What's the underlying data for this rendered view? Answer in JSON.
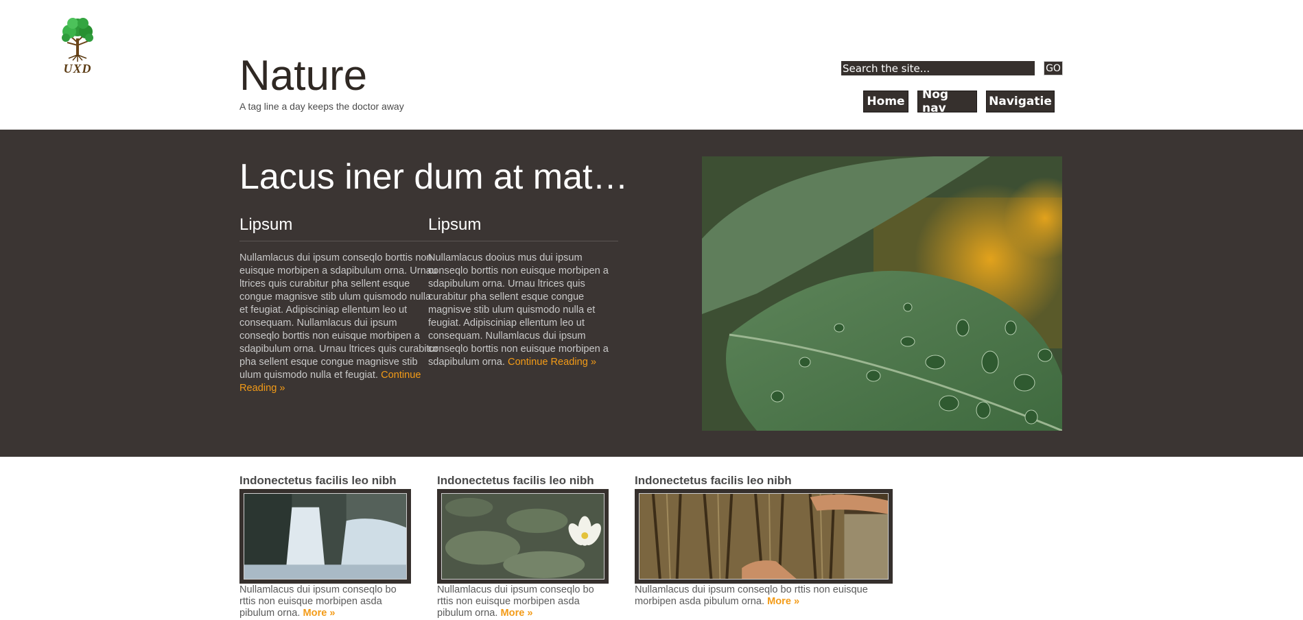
{
  "header": {
    "logo_text": "UXD",
    "site_title": "Nature",
    "tagline": "A tag line a day keeps the doctor away",
    "search_placeholder": "Search the site...",
    "go_label": "GO",
    "nav": [
      {
        "label": "Home"
      },
      {
        "label": "Nog nav"
      },
      {
        "label": "Navigatie"
      }
    ]
  },
  "hero": {
    "title": "Lacus iner dum at mat…",
    "columns": [
      {
        "heading": "Lipsum",
        "body": "Nullamlacus dui ipsum conseqlo borttis non euisque morbipen a sdapibulum orna. Urnau ltrices quis curabitur pha sellent esque congue magnisve stib ulum quismodo nulla et feugiat. Adipisciniap ellentum leo ut consequam. Nullamlacus dui ipsum conseqlo borttis non euisque morbipen a sdapibulum orna. Urnau ltrices quis curabitur pha sellent esque congue magnisve stib ulum quismodo nulla et feugiat.",
        "link": "Continue Reading »"
      },
      {
        "heading": "Lipsum",
        "body": "Nullamlacus dooius mus dui ipsum conseqlo borttis non euisque morbipen a sdapibulum orna. Urnau ltrices quis curabitur pha sellent esque congue magnisve stib ulum quismodo nulla et feugiat. Adipisciniap ellentum leo ut consequam. Nullamlacus dui ipsum conseqlo borttis non euisque morbipen a sdapibulum orna.",
        "link": "Continue Reading »"
      }
    ],
    "image_icon": "leaf-with-raindrops-photo"
  },
  "cards": [
    {
      "title": "Indonectetus facilis leo nibh",
      "image_icon": "waterfall-photo",
      "text": "Nullamlacus dui ipsum conseqlo bo rttis non euisque morbipen asda pibulum orna.",
      "more": "More »"
    },
    {
      "title": "Indonectetus facilis leo nibh",
      "image_icon": "water-lily-photo",
      "text": "Nullamlacus dui ipsum conseqlo bo rttis non euisque morbipen asda pibulum orna.",
      "more": "More »"
    },
    {
      "title": "Indonectetus facilis leo nibh",
      "image_icon": "tree-bark-hands-photo",
      "text": "Nullamlacus dui ipsum conseqlo bo rttis non euisque morbipen asda pibulum orna.",
      "more": "More »"
    }
  ],
  "colors": {
    "dark_band": "#3b3533",
    "accent": "#f39b17",
    "nav_bg": "#36302d"
  }
}
